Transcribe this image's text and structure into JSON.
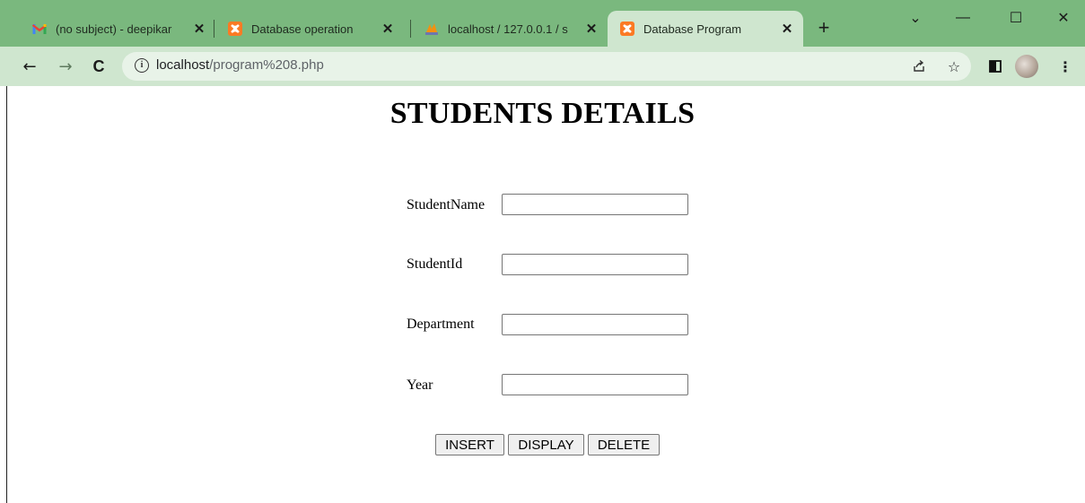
{
  "browser": {
    "tabs": [
      {
        "title": "(no subject) - deepikar",
        "icon": "gmail-icon",
        "active": false
      },
      {
        "title": "Database operation",
        "icon": "xampp-icon",
        "active": false
      },
      {
        "title": "localhost / 127.0.0.1 / s",
        "icon": "phpmyadmin-icon",
        "active": false
      },
      {
        "title": "Database Program",
        "icon": "xampp-icon",
        "active": true
      }
    ],
    "new_tab_glyph": "+",
    "window_controls": {
      "dropdown": "⌄",
      "minimize": "—",
      "maximize": "☐",
      "close": "✕"
    },
    "url_host": "localhost",
    "url_path": "/program%208.php",
    "accent_color": "#7ab87e",
    "active_color": "#cfe6cf"
  },
  "page": {
    "heading": "STUDENTS DETAILS",
    "fields": [
      {
        "label": "StudentName",
        "value": ""
      },
      {
        "label": "StudentId",
        "value": ""
      },
      {
        "label": "Department",
        "value": ""
      },
      {
        "label": "Year",
        "value": ""
      }
    ],
    "buttons": {
      "insert": "INSERT",
      "display": "DISPLAY",
      "delete": "DELETE"
    }
  }
}
